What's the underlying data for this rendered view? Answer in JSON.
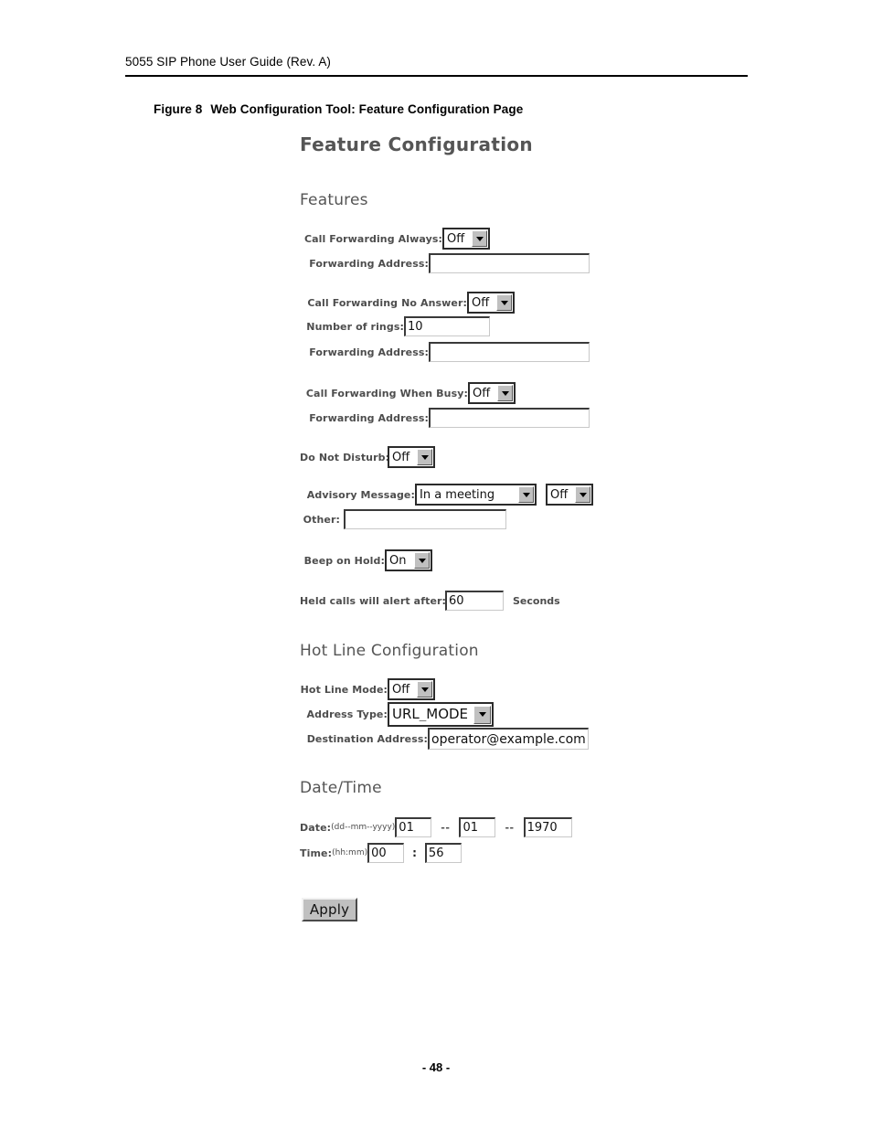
{
  "page": {
    "header": "5055 SIP Phone User Guide (Rev. A)",
    "figure_number": "Figure 8",
    "figure_title": "Web Configuration Tool: Feature Configuration Page",
    "footer": "- 48 -"
  },
  "screenshot": {
    "title": "Feature Configuration",
    "sections": {
      "features": {
        "heading": "Features",
        "call_forwarding_always": {
          "label": "Call Forwarding Always:",
          "value": "Off"
        },
        "cfa_forwarding_address": {
          "label": "Forwarding Address:",
          "value": ""
        },
        "call_forwarding_no_answer": {
          "label": "Call Forwarding No Answer:",
          "value": "Off"
        },
        "number_of_rings": {
          "label": "Number of rings:",
          "value": "10"
        },
        "cfna_forwarding_address": {
          "label": "Forwarding Address:",
          "value": ""
        },
        "call_forwarding_when_busy": {
          "label": "Call Forwarding When Busy:",
          "value": "Off"
        },
        "cfb_forwarding_address": {
          "label": "Forwarding Address:",
          "value": ""
        },
        "do_not_disturb": {
          "label": "Do Not Disturb:",
          "value": "Off"
        },
        "advisory_message": {
          "label": "Advisory Message:",
          "value": "In a meeting",
          "toggle": "Off"
        },
        "advisory_other": {
          "label": "Other:",
          "value": ""
        },
        "beep_on_hold": {
          "label": "Beep on Hold:",
          "value": "On"
        },
        "held_calls_alert": {
          "label": "Held calls will alert after:",
          "value": "60",
          "units": "Seconds"
        }
      },
      "hot_line": {
        "heading": "Hot Line Configuration",
        "hot_line_mode": {
          "label": "Hot Line Mode:",
          "value": "Off"
        },
        "address_type": {
          "label": "Address Type:",
          "value": "URL_MODE"
        },
        "destination_address": {
          "label": "Destination Address:",
          "value": "operator@example.com"
        }
      },
      "date_time": {
        "heading": "Date/Time",
        "date": {
          "label": "Date:",
          "hint": "(dd--mm--yyyy)",
          "day": "01",
          "month": "01",
          "year": "1970",
          "separator": "--"
        },
        "time": {
          "label": "Time:",
          "hint": "(hh:mm)",
          "hours": "00",
          "minutes": "56",
          "separator": ":"
        }
      }
    },
    "apply_button": "Apply"
  }
}
